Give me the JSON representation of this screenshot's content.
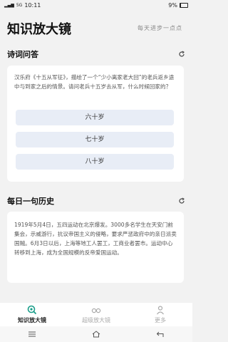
{
  "status": {
    "time": "10:11",
    "carrier": "5G",
    "battery": "9%"
  },
  "header": {
    "title": "知识放大镜",
    "subtitle": "每天进步一点点"
  },
  "quiz": {
    "title": "诗词问答",
    "question": "汉乐府《十五从军征》，描绘了一个“少小离家老大回”的老兵返乡途中与到家之后的情景。请问老兵十五岁去从军，什么时候回家的？",
    "options": [
      "六十岁",
      "七十岁",
      "八十岁"
    ]
  },
  "history": {
    "title": "每日一句历史",
    "text": "1919年5月4日，五四运动在北京爆发。3000多名学生在天安门前集会，示威游行，抗议帝国主义的侵略，要求严惩政府中的亲日派卖国贼。6月3日以后，上海等地工人罢工，工商业者罢市。运动中心转移到上海，成为全国规模的反帝爱国运动。"
  },
  "nav": {
    "items": [
      "知识放大镜",
      "超级放大镜",
      "更多"
    ]
  },
  "icons": [
    "refresh-icon",
    "magnifier-icon",
    "glasses-icon",
    "user-icon",
    "menu-icon",
    "home-icon",
    "back-icon",
    "battery-icon",
    "signal-icon"
  ]
}
